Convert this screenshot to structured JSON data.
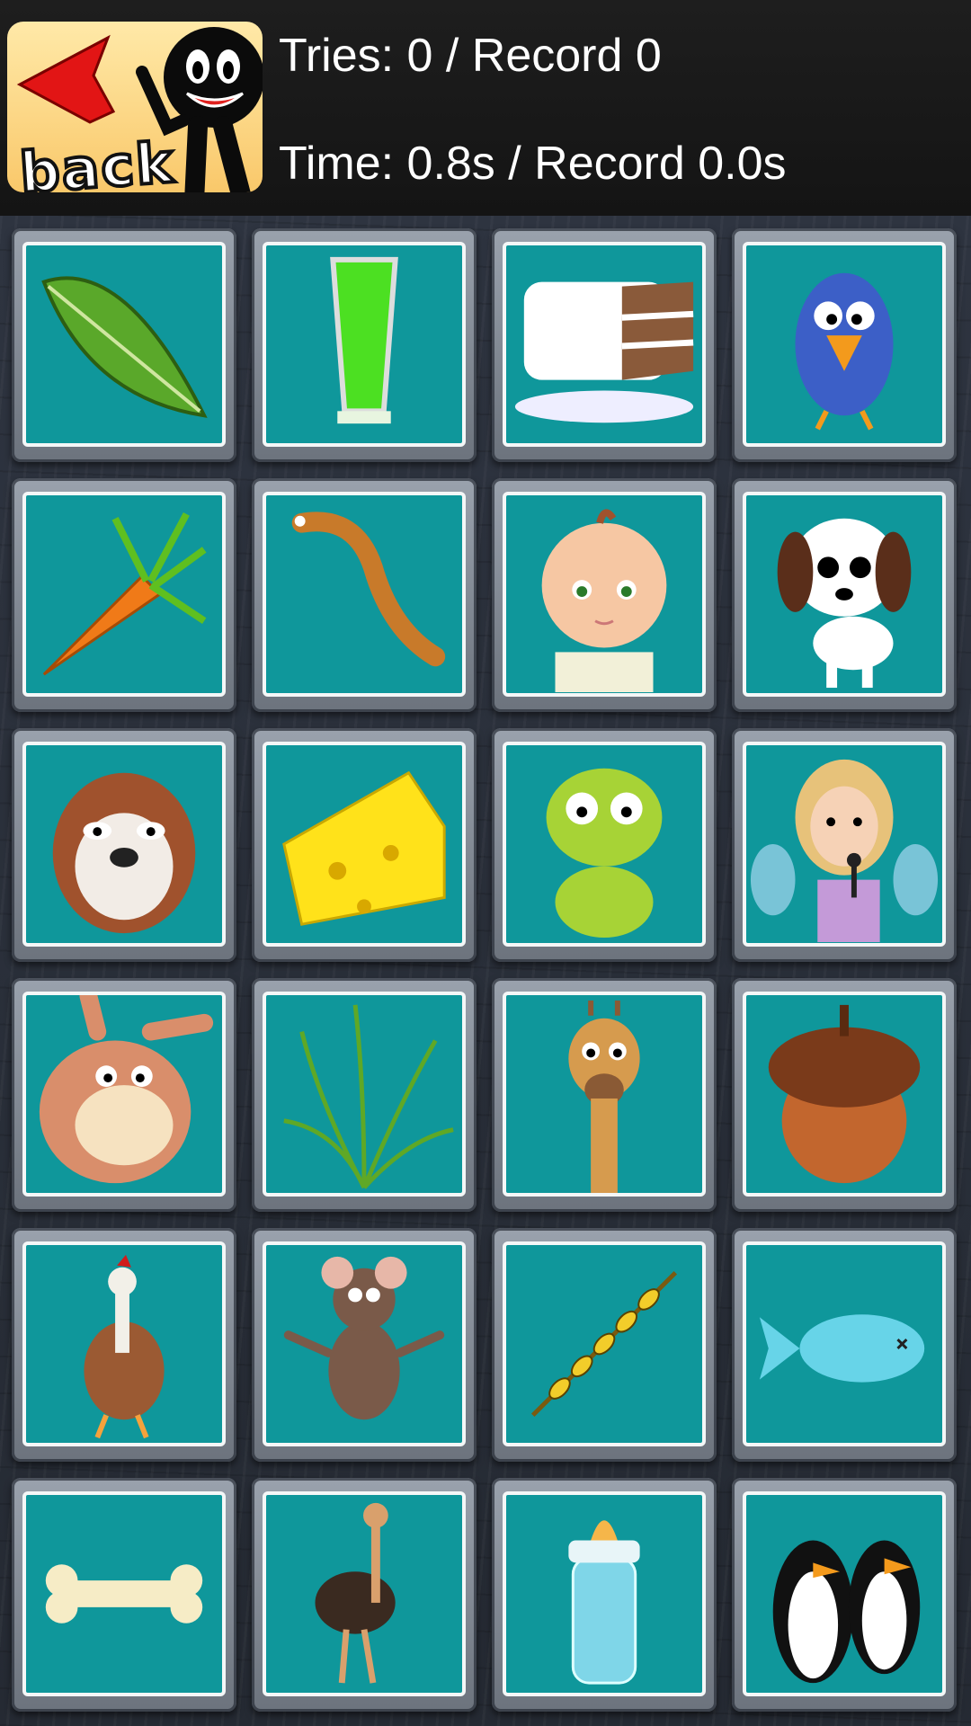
{
  "header": {
    "back_label": "back",
    "tries_text": "Tries: 0 / Record 0",
    "time_text": "Time: 0.8s / Record 0.0s"
  },
  "colors": {
    "card_face": "#0f979b",
    "back_arrow": "#e21515",
    "header_bg": "#181818"
  },
  "cards": [
    {
      "icon": "leaf-icon"
    },
    {
      "icon": "green-juice-glass-icon"
    },
    {
      "icon": "layer-cake-icon"
    },
    {
      "icon": "blue-bird-icon"
    },
    {
      "icon": "carrot-icon"
    },
    {
      "icon": "worm-icon"
    },
    {
      "icon": "baby-icon"
    },
    {
      "icon": "puppy-icon"
    },
    {
      "icon": "squirrel-icon"
    },
    {
      "icon": "cheese-icon"
    },
    {
      "icon": "frog-icon"
    },
    {
      "icon": "fairy-singer-icon"
    },
    {
      "icon": "donkey-icon"
    },
    {
      "icon": "grass-icon"
    },
    {
      "icon": "giraffe-icon"
    },
    {
      "icon": "acorn-icon"
    },
    {
      "icon": "rooster-icon"
    },
    {
      "icon": "mouse-icon"
    },
    {
      "icon": "wheat-icon"
    },
    {
      "icon": "fish-icon"
    },
    {
      "icon": "bone-icon"
    },
    {
      "icon": "ostrich-icon"
    },
    {
      "icon": "baby-bottle-icon"
    },
    {
      "icon": "penguins-icon"
    }
  ]
}
